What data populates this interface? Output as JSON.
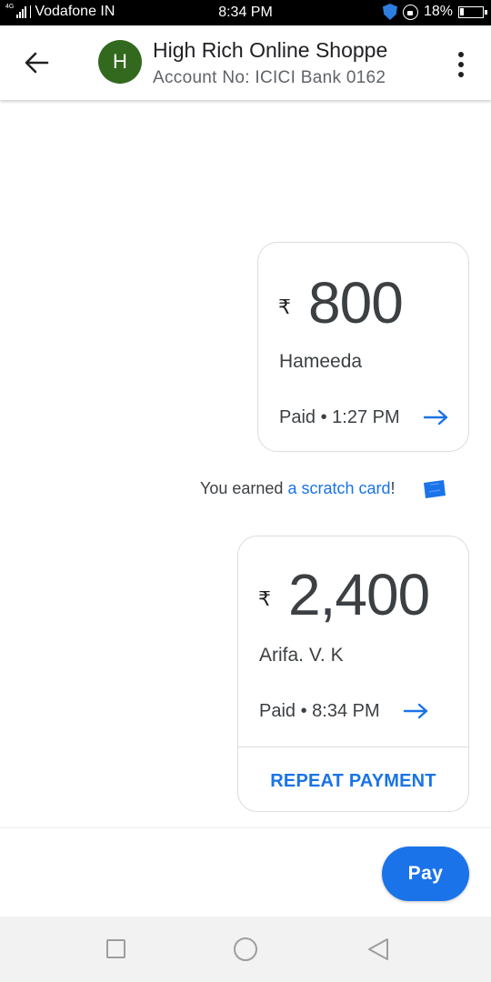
{
  "status_bar": {
    "network": "4G",
    "carrier": "Vodafone IN",
    "time": "8:34 PM",
    "battery": "18%"
  },
  "header": {
    "avatar_letter": "H",
    "title": "High Rich Online Shoppe",
    "subtitle": "Account No: ICICI Bank 0162",
    "back_icon": "arrow-back-icon",
    "more_icon": "more-vert-icon",
    "avatar_color": "#33691e"
  },
  "transactions": [
    {
      "currency": "₹",
      "amount": "800",
      "payee": "Hameeda",
      "status": "Paid • 1:27 PM"
    },
    {
      "currency": "₹",
      "amount": "2,400",
      "payee": "Arifa. V. K",
      "status": "Paid • 8:34 PM",
      "action": "REPEAT PAYMENT"
    }
  ],
  "scratch": {
    "prefix": "You earned ",
    "link": "a scratch card",
    "suffix": "!"
  },
  "footer": {
    "pay_label": "Pay"
  },
  "colors": {
    "accent": "#1a73e8",
    "text": "#3c4043"
  }
}
